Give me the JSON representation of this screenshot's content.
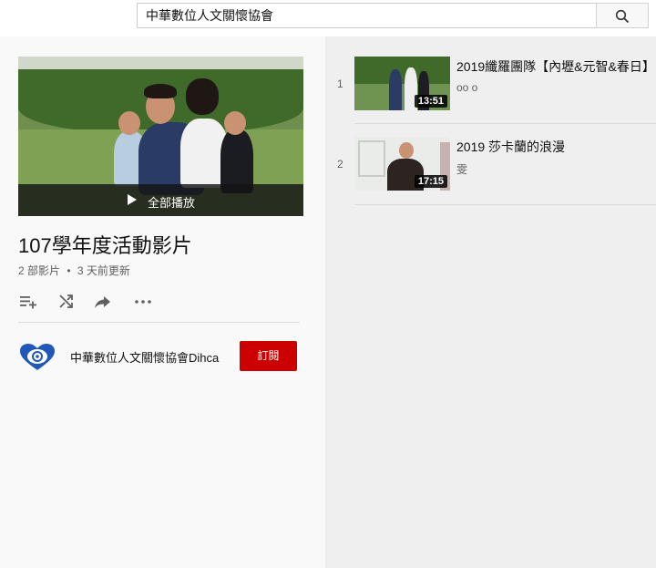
{
  "search": {
    "value": "中華數位人文關懷協會",
    "button_icon": "search-icon"
  },
  "playlist": {
    "play_all_label": "全部播放",
    "title": "107學年度活動影片",
    "video_count": "2 部影片",
    "updated": "3 天前更新",
    "meta_separator": "•",
    "actions": [
      "add-to-queue-icon",
      "shuffle-icon",
      "share-icon",
      "more-icon"
    ]
  },
  "owner": {
    "name": "中華數位人文關懷協會Dihca",
    "subscribe_label": "訂閱",
    "subscribe_color": "#cc0000"
  },
  "videos": [
    {
      "index": "1",
      "title": "2019纖羅團隊【內壢&元智&春日】",
      "channel": "oo o",
      "duration": "13:51"
    },
    {
      "index": "2",
      "title": "2019 莎卡蘭的浪漫",
      "channel": "雯",
      "duration": "17:15"
    }
  ]
}
